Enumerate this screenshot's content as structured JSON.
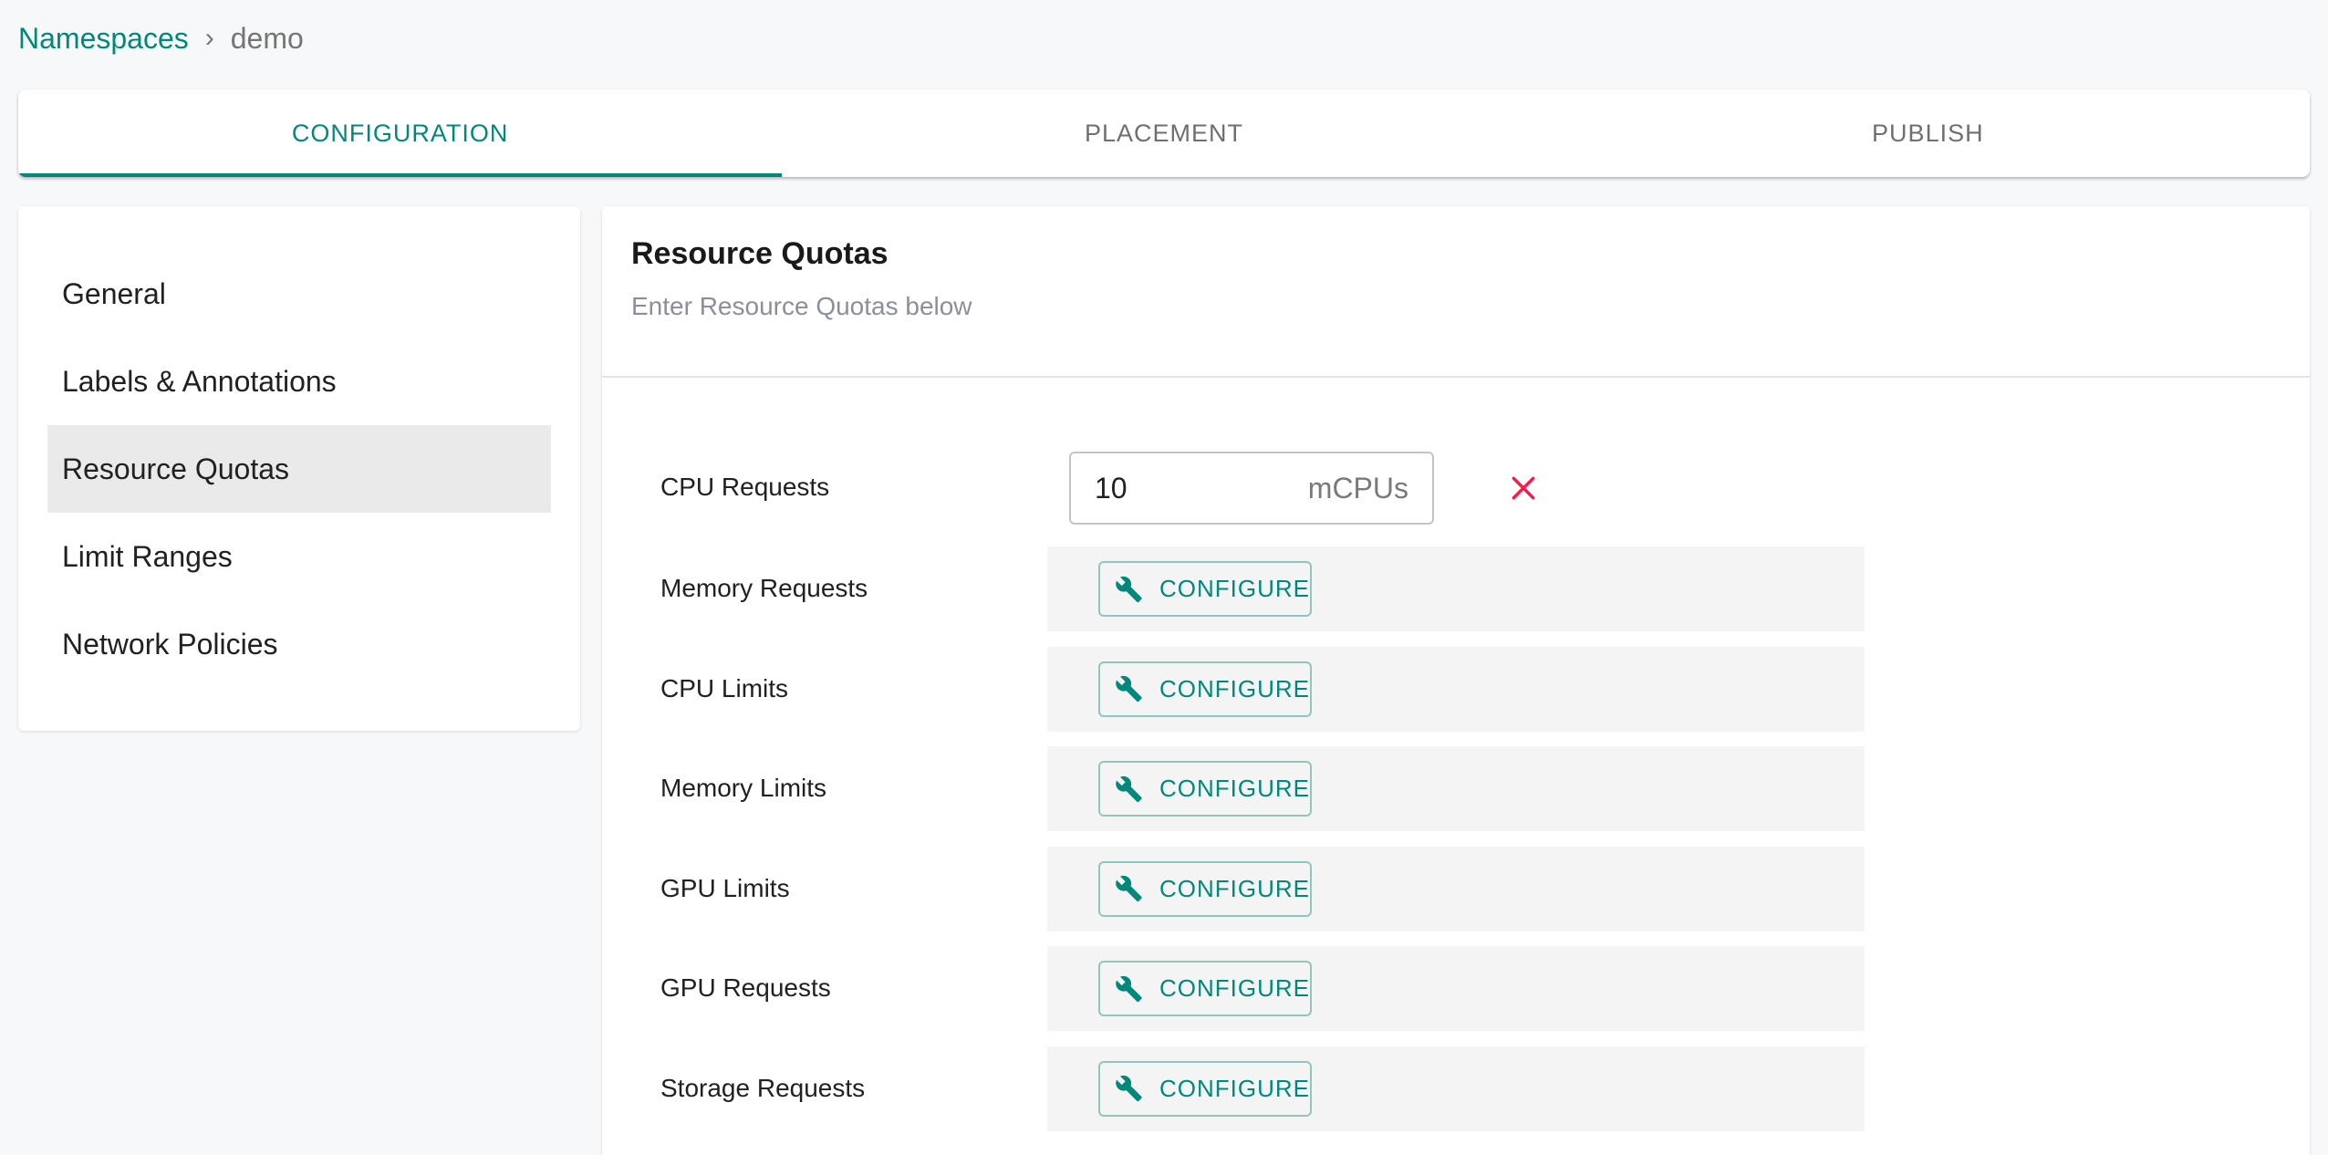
{
  "breadcrumb": {
    "parent": "Namespaces",
    "separator": "›",
    "current": "demo"
  },
  "tabs": [
    {
      "label": "CONFIGURATION",
      "active": true
    },
    {
      "label": "PLACEMENT",
      "active": false
    },
    {
      "label": "PUBLISH",
      "active": false
    }
  ],
  "sidebar": {
    "items": [
      {
        "label": "General",
        "selected": false
      },
      {
        "label": "Labels & Annotations",
        "selected": false
      },
      {
        "label": "Resource Quotas",
        "selected": true
      },
      {
        "label": "Limit Ranges",
        "selected": false
      },
      {
        "label": "Network Policies",
        "selected": false
      }
    ]
  },
  "main": {
    "title": "Resource Quotas",
    "subtitle": "Enter Resource Quotas below",
    "cpu_requests": {
      "label": "CPU Requests",
      "value": "10",
      "unit": "mCPUs",
      "remove_icon": "close-icon"
    },
    "configure_rows": [
      {
        "label": "Memory Requests",
        "button": "CONFIGURE",
        "icon": "wrench-icon"
      },
      {
        "label": "CPU Limits",
        "button": "CONFIGURE",
        "icon": "wrench-icon"
      },
      {
        "label": "Memory Limits",
        "button": "CONFIGURE",
        "icon": "wrench-icon"
      },
      {
        "label": "GPU Limits",
        "button": "CONFIGURE",
        "icon": "wrench-icon"
      },
      {
        "label": "GPU Requests",
        "button": "CONFIGURE",
        "icon": "wrench-icon"
      },
      {
        "label": "Storage Requests",
        "button": "CONFIGURE",
        "icon": "wrench-icon"
      }
    ]
  },
  "colors": {
    "accent": "#00897b",
    "danger": "#ff1744",
    "background": "#f7f8fa",
    "selected_item": "#eaeaea",
    "band": "#f4f4f4"
  }
}
